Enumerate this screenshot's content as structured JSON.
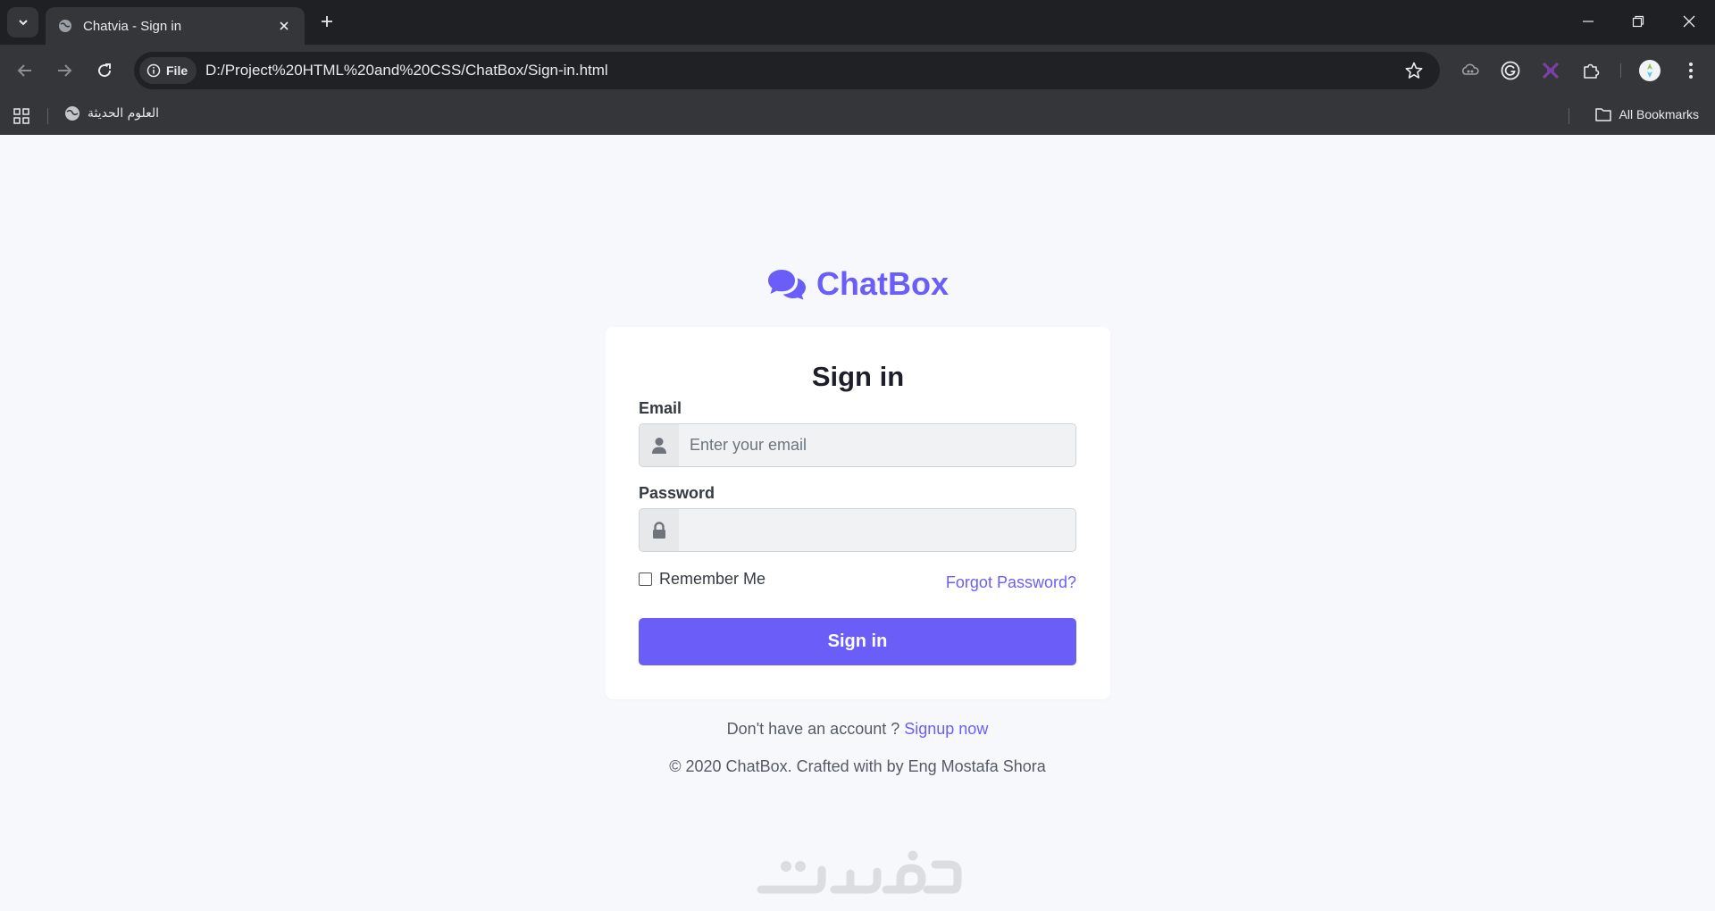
{
  "browser": {
    "tab_title": "Chatvia - Sign in",
    "file_chip": "File",
    "url": "D:/Project%20HTML%20and%20CSS/ChatBox/Sign-in.html",
    "bookmark_item": "العلوم الحديثة",
    "all_bookmarks": "All Bookmarks"
  },
  "brand": {
    "name": "ChatBox",
    "accent_color": "#6b5ef8",
    "logo_icon": "comments-icon"
  },
  "form": {
    "title": "Sign in",
    "email_label": "Email",
    "email_placeholder": "Enter your email",
    "email_value": "",
    "email_icon": "user-icon",
    "password_label": "Password",
    "password_value": "",
    "password_icon": "lock-icon",
    "remember_label": "Remember Me",
    "remember_checked": false,
    "forgot_label": "Forgot Password?",
    "submit_label": "Sign in"
  },
  "footer": {
    "signup_prompt": "Don't have an account ? ",
    "signup_link": "Signup now",
    "copyright": "© 2020 ChatBox. Crafted with by Eng Mostafa Shora"
  },
  "watermark": {
    "text": "خمسات"
  }
}
